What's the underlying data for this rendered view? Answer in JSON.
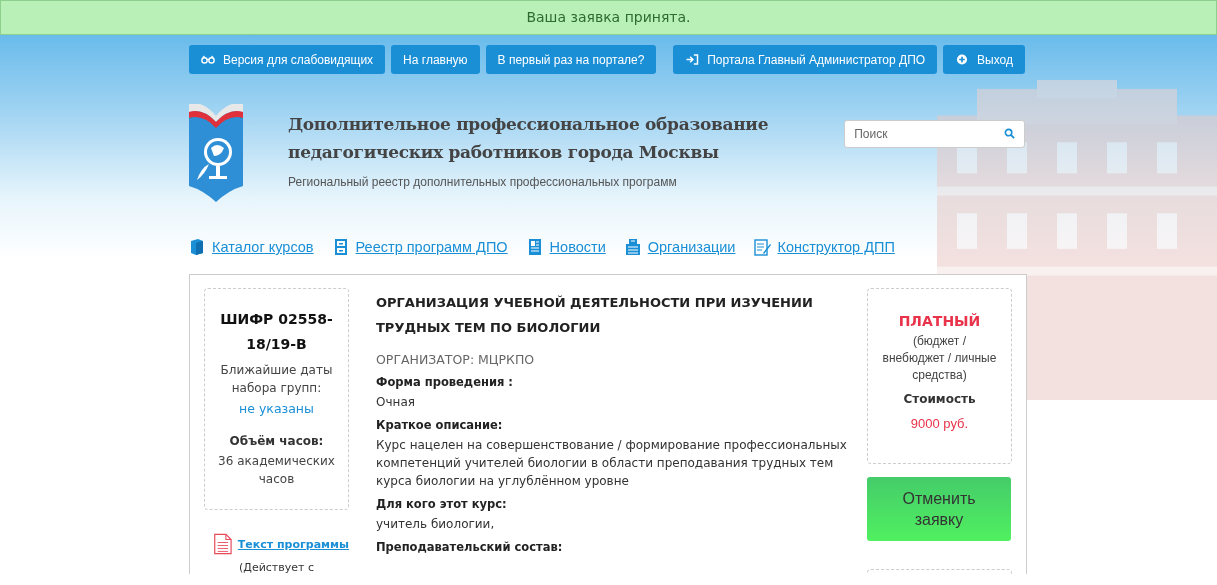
{
  "notice": "Ваша заявка принята.",
  "top_buttons_left": [
    "Версия для слабовидящих",
    "На главную",
    "В первый раз на портале?"
  ],
  "top_buttons_right": [
    "Портала Главный Администратор ДПО",
    "Выход"
  ],
  "header": {
    "title": "Дополнительное профессиональное образование педагогических работников города Москвы",
    "subtitle": "Региональный реестр дополнительных профессиональных программ"
  },
  "search": {
    "placeholder": "Поиск"
  },
  "nav": [
    "Каталог курсов",
    "Реестр программ ДПО",
    "Новости",
    "Организации",
    "Конструктор ДПП"
  ],
  "course": {
    "code": "ШИФР 02558-18/19-В",
    "dates_label": "Ближайшие даты набора групп:",
    "dates_value": "не указаны",
    "hours_label": "Объём часов:",
    "hours_value": "36 академических часов",
    "program_link": "Текст программы",
    "program_note": "(Действует с",
    "title": "ОРГАНИЗАЦИЯ УЧЕБНОЙ ДЕЯТЕЛЬНОСТИ ПРИ ИЗУЧЕНИИ ТРУДНЫХ ТЕМ ПО БИОЛОГИИ",
    "organizer": "ОРГАНИЗАТОР: МЦРКПО",
    "sections": [
      {
        "heading": "Форма проведения :",
        "text": "Очная"
      },
      {
        "heading": "Краткое описание:",
        "text": "Курс нацелен на совершенствование / формирование профессиональных компетенций учителей биологии в области преподавания трудных тем курса биологии на углублённом уровне"
      },
      {
        "heading": "Для кого этот курс:",
        "text": "учитель биологии,"
      },
      {
        "heading": "Преподавательский состав:"
      }
    ],
    "price": {
      "type": "ПЛАТНЫЙ",
      "note": "(бюджет / внебюджет / личные средства)",
      "cost_label": "Стоимость",
      "cost": "9000 руб."
    },
    "cancel_button": "Отменить заявку"
  }
}
